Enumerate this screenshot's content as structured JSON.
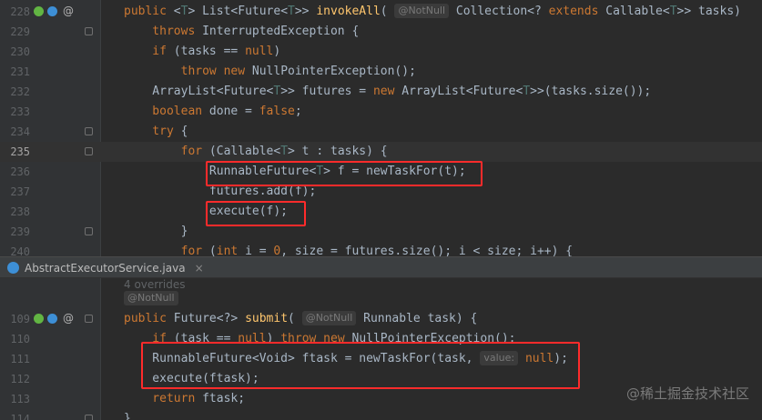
{
  "colors": {
    "keyword": "#cc7832",
    "type_param": "#507874",
    "method": "#ffc66d",
    "text": "#a9b7c6",
    "highlight_box": "#ff2b2b"
  },
  "top_pane": {
    "lines": [
      {
        "num": "228",
        "parts": [
          [
            "kw",
            "public "
          ],
          [
            "plain",
            "<"
          ],
          [
            "tp",
            "T"
          ],
          [
            "plain",
            "> List<Future<"
          ],
          [
            "tp",
            "T"
          ],
          [
            "plain",
            ">> "
          ],
          [
            "fn",
            "invokeAll"
          ],
          [
            "plain",
            "( "
          ],
          [
            "hint",
            "@NotNull"
          ],
          [
            "plain",
            " Collection<? "
          ],
          [
            "kw",
            "extends "
          ],
          [
            "plain",
            "Callable<"
          ],
          [
            "tp",
            "T"
          ],
          [
            "plain",
            ">> tasks)"
          ]
        ]
      },
      {
        "num": "229",
        "parts": [
          [
            "kw",
            "    throws "
          ],
          [
            "plain",
            "InterruptedException {"
          ]
        ]
      },
      {
        "num": "230",
        "parts": [
          [
            "kw",
            "    if "
          ],
          [
            "plain",
            "(tasks == "
          ],
          [
            "kw",
            "null"
          ],
          [
            "plain",
            ")"
          ]
        ]
      },
      {
        "num": "231",
        "parts": [
          [
            "kw",
            "        throw new "
          ],
          [
            "plain",
            "NullPointerException();"
          ]
        ]
      },
      {
        "num": "232",
        "parts": [
          [
            "plain",
            "    ArrayList<Future<"
          ],
          [
            "tp",
            "T"
          ],
          [
            "plain",
            ">> futures = "
          ],
          [
            "kw",
            "new "
          ],
          [
            "plain",
            "ArrayList<Future<"
          ],
          [
            "tp",
            "T"
          ],
          [
            "plain",
            ">>(tasks.size());"
          ]
        ]
      },
      {
        "num": "233",
        "parts": [
          [
            "kw",
            "    boolean "
          ],
          [
            "plain",
            "done = "
          ],
          [
            "kw",
            "false"
          ],
          [
            "plain",
            ";"
          ]
        ]
      },
      {
        "num": "234",
        "parts": [
          [
            "kw",
            "    try "
          ],
          [
            "plain",
            "{"
          ]
        ]
      },
      {
        "num": "235",
        "parts": [
          [
            "kw",
            "        for "
          ],
          [
            "plain",
            "(Callable<"
          ],
          [
            "tp",
            "T"
          ],
          [
            "plain",
            "> t : tasks) {"
          ]
        ]
      },
      {
        "num": "236",
        "parts": [
          [
            "plain",
            "            RunnableFuture<"
          ],
          [
            "tp",
            "T"
          ],
          [
            "plain",
            "> f = newTaskFor(t);"
          ]
        ]
      },
      {
        "num": "237",
        "parts": [
          [
            "plain",
            "            futures.add(f);"
          ]
        ]
      },
      {
        "num": "238",
        "parts": [
          [
            "plain",
            "            execute(f);"
          ]
        ]
      },
      {
        "num": "239",
        "parts": [
          [
            "plain",
            "        }"
          ]
        ]
      },
      {
        "num": "240",
        "parts": [
          [
            "kw",
            "        for "
          ],
          [
            "plain",
            "("
          ],
          [
            "kw",
            "int "
          ],
          [
            "plain",
            "i = "
          ],
          [
            "kw",
            "0"
          ],
          [
            "plain",
            ", size = futures.size(); i < size; i++) {"
          ]
        ]
      }
    ]
  },
  "tab": {
    "filename": "AbstractExecutorService.java",
    "close": "×"
  },
  "bottom_pane": {
    "overrides_hint": "4 overrides",
    "lines": [
      {
        "num": "",
        "parts": [
          [
            "hint",
            "@NotNull"
          ]
        ]
      },
      {
        "num": "109",
        "parts": [
          [
            "kw",
            "public "
          ],
          [
            "plain",
            "Future<?> "
          ],
          [
            "fn",
            "submit"
          ],
          [
            "plain",
            "( "
          ],
          [
            "hint",
            "@NotNull"
          ],
          [
            "plain",
            " Runnable task) {"
          ]
        ]
      },
      {
        "num": "110",
        "parts": [
          [
            "kw",
            "    if "
          ],
          [
            "plain",
            "(task == "
          ],
          [
            "kw",
            "null"
          ],
          [
            "plain",
            ") "
          ],
          [
            "kw",
            "throw new "
          ],
          [
            "plain",
            "NullPointerException();"
          ]
        ]
      },
      {
        "num": "111",
        "parts": [
          [
            "plain",
            "    RunnableFuture<Void> ftask = newTaskFor(task, "
          ],
          [
            "hint",
            "value:"
          ],
          [
            "plain",
            " "
          ],
          [
            "kw",
            "null"
          ],
          [
            "plain",
            ");"
          ]
        ]
      },
      {
        "num": "112",
        "parts": [
          [
            "plain",
            "    execute(ftask);"
          ]
        ]
      },
      {
        "num": "113",
        "parts": [
          [
            "kw",
            "    return "
          ],
          [
            "plain",
            "ftask;"
          ]
        ]
      },
      {
        "num": "114",
        "parts": [
          [
            "plain",
            "}"
          ]
        ]
      }
    ]
  },
  "watermark": "@稀土掘金技术社区"
}
